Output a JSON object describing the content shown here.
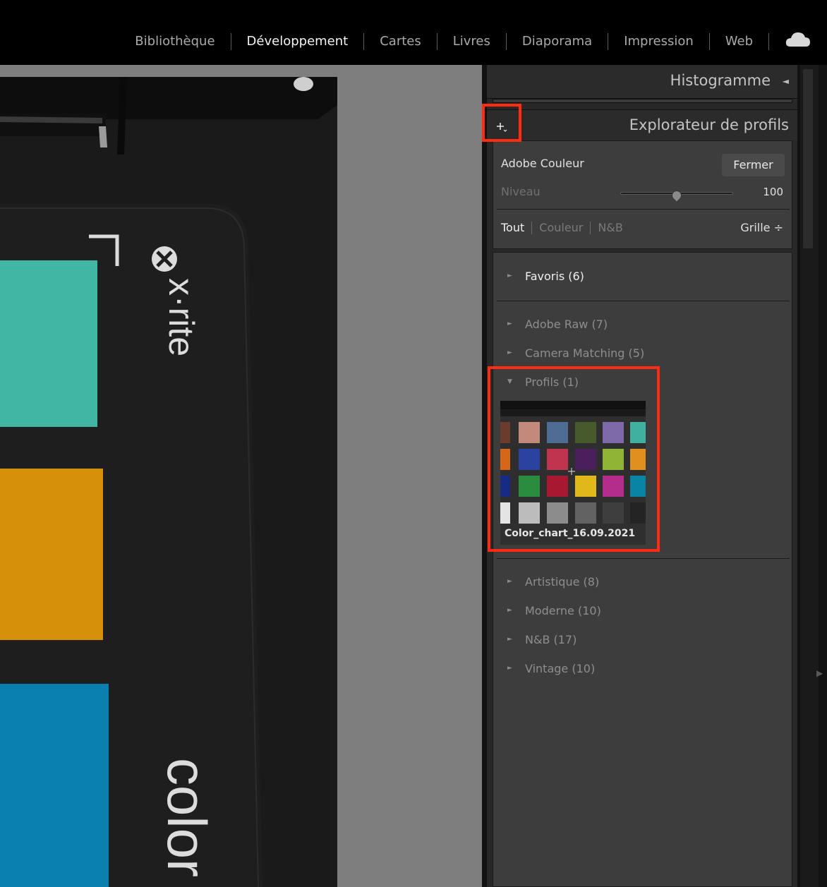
{
  "top_modules": {
    "library": "Bibliothèque",
    "develop": "Développement",
    "maps": "Cartes",
    "books": "Livres",
    "slideshow": "Diaporama",
    "print": "Impression",
    "web": "Web"
  },
  "photo": {
    "brand": "x·rite",
    "brand_bottom": "color"
  },
  "histogram": {
    "title": "Histogramme",
    "toggle": "◄"
  },
  "profile_browser": {
    "title": "Explorateur de profils",
    "current_profile": "Adobe Couleur",
    "close_label": "Fermer",
    "amount_label": "Niveau",
    "amount_value": "100",
    "filters": [
      "Tout",
      "Couleur",
      "N&B"
    ],
    "view": "Grille ÷",
    "groups": [
      {
        "label": "Favoris (6)",
        "expanded": false
      },
      {
        "label": "Adobe Raw (7)",
        "expanded": false
      },
      {
        "label": "Camera Matching (5)",
        "expanded": false
      },
      {
        "label": "Profils (1)",
        "expanded": true
      },
      {
        "label": "Artistique (8)",
        "expanded": false
      },
      {
        "label": "Moderne (10)",
        "expanded": false
      },
      {
        "label": "N&B (17)",
        "expanded": false
      },
      {
        "label": "Vintage (10)",
        "expanded": false
      }
    ],
    "custom_profile_thumb": "Color_chart_16.09.2021"
  },
  "colors": {
    "highlight": "#ff2a12",
    "panel_bg": "#3d3d3d",
    "header_bg": "#2b2b2b"
  },
  "icons": {
    "cloud": "cloud-icon",
    "add": "plus-icon",
    "collapsed": "triangle-right-icon",
    "expanded": "triangle-down-icon"
  }
}
